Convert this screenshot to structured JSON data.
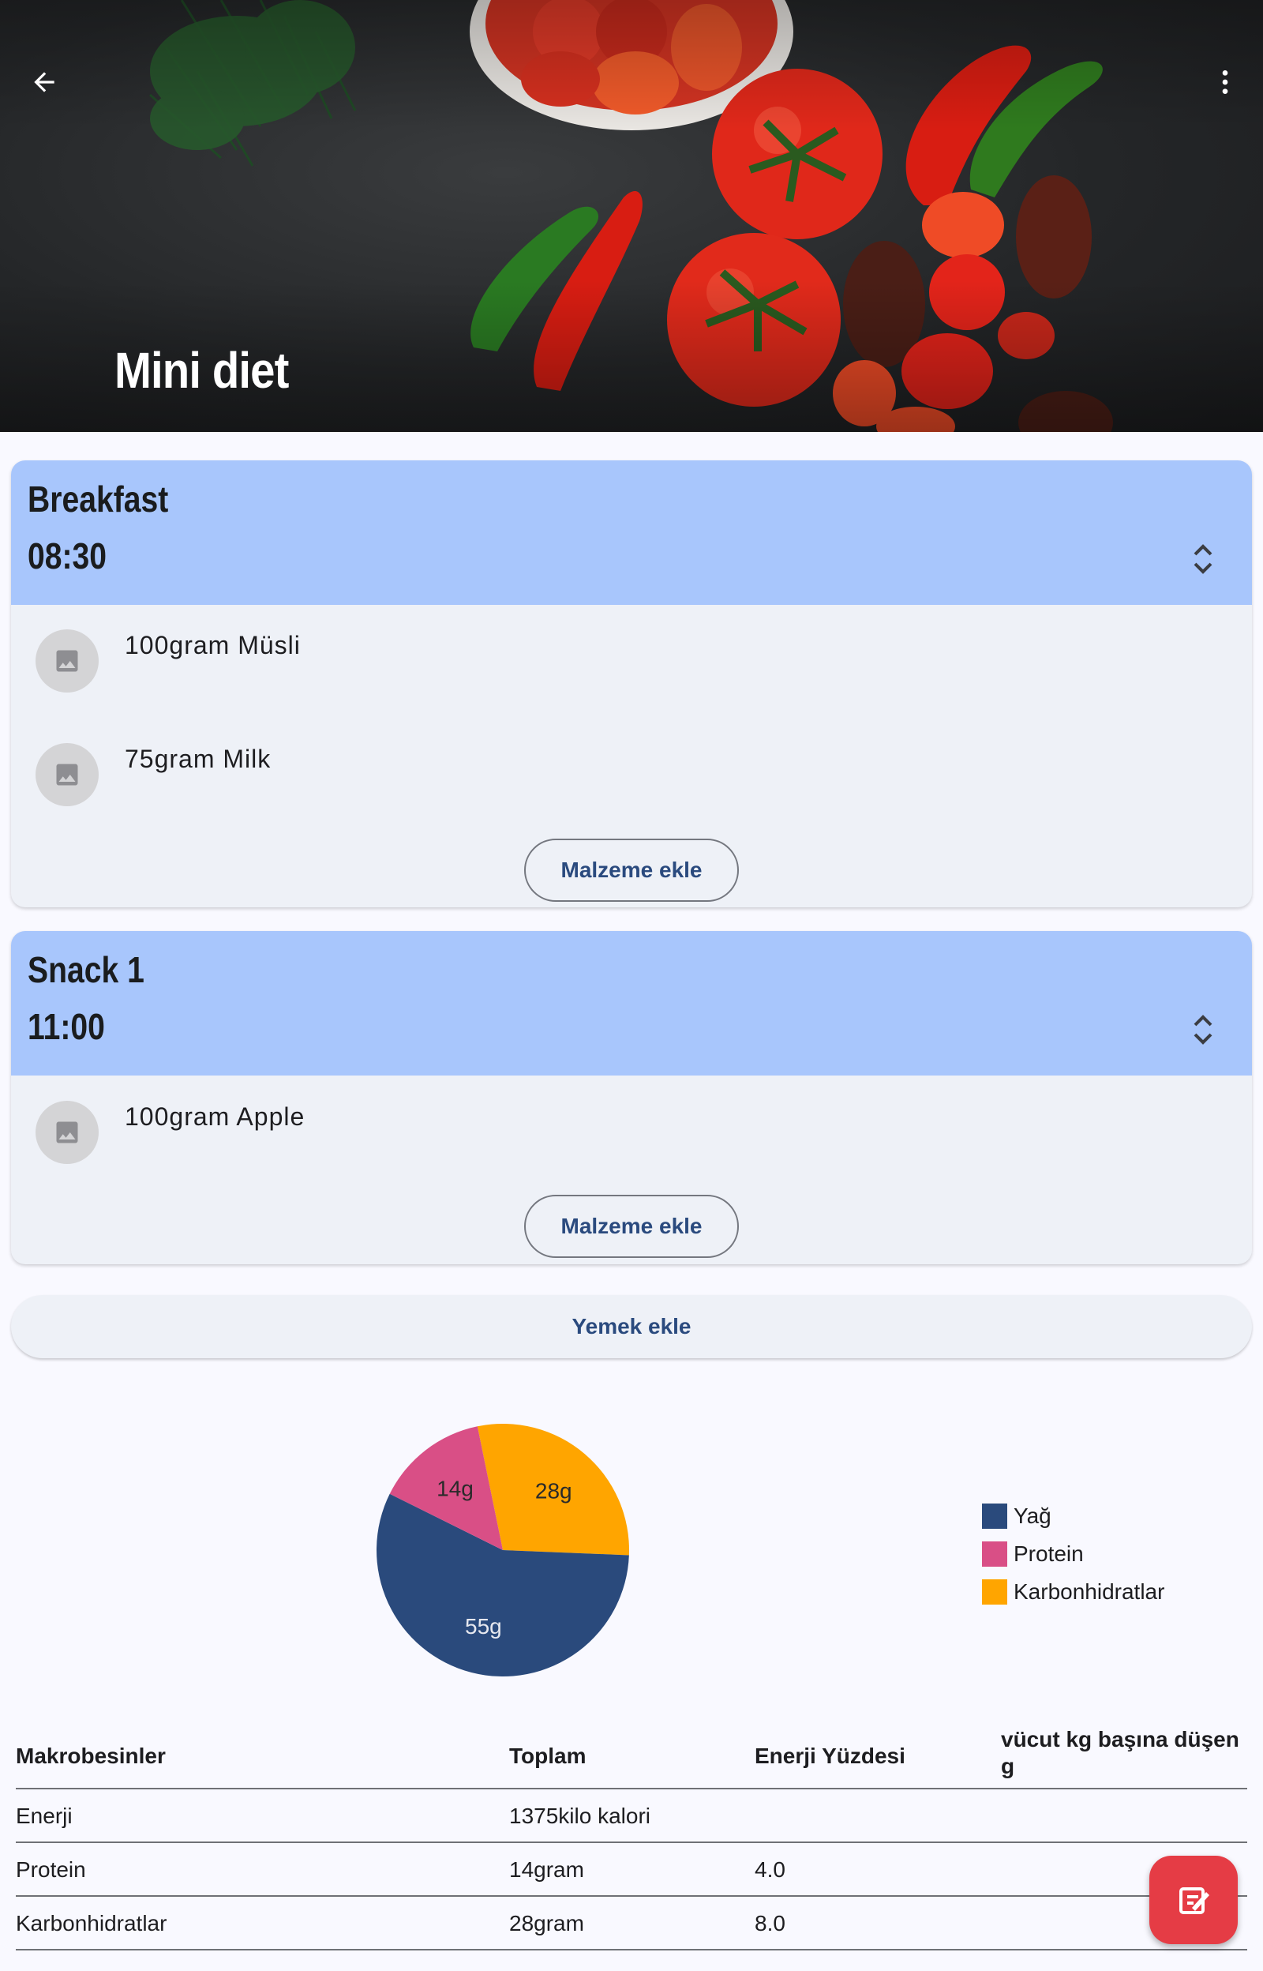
{
  "header": {
    "title": "Mini diet",
    "back_icon": "arrow-back-icon",
    "menu_icon": "more-vert-icon"
  },
  "meals": [
    {
      "name": "Breakfast",
      "time": "08:30",
      "ingredients": [
        "100gram Müsli",
        "75gram Milk"
      ],
      "add_button": "Malzeme ekle"
    },
    {
      "name": "Snack 1",
      "time": "11:00",
      "ingredients": [
        "100gram Apple"
      ],
      "add_button": "Malzeme ekle"
    }
  ],
  "add_meal_button": "Yemek ekle",
  "chart_data": {
    "type": "pie",
    "title": "",
    "slices": [
      {
        "name": "Yağ",
        "value": 55,
        "label": "55g",
        "color": "#2a4a7c"
      },
      {
        "name": "Protein",
        "value": 14,
        "label": "14g",
        "color": "#d94f86"
      },
      {
        "name": "Karbonhidratlar",
        "value": 28,
        "label": "28g",
        "color": "#ffa500"
      }
    ],
    "legend_position": "right"
  },
  "table": {
    "headers": [
      "Makrobesinler",
      "Toplam",
      "Enerji Yüzdesi",
      "vücut kg başına düşen g"
    ],
    "rows": [
      [
        "Enerji",
        "1375kilo kalori",
        "",
        ""
      ],
      [
        "Protein",
        "14gram",
        "4.0",
        ""
      ],
      [
        "Karbonhidratlar",
        "28gram",
        "8.0",
        ""
      ]
    ]
  },
  "colors": {
    "meal_header": "#a8c6fc",
    "card_bg": "#eef1f7",
    "accent_text": "#2a4a7e",
    "fab": "#e53c45"
  },
  "fab_icon": "edit-document-icon"
}
